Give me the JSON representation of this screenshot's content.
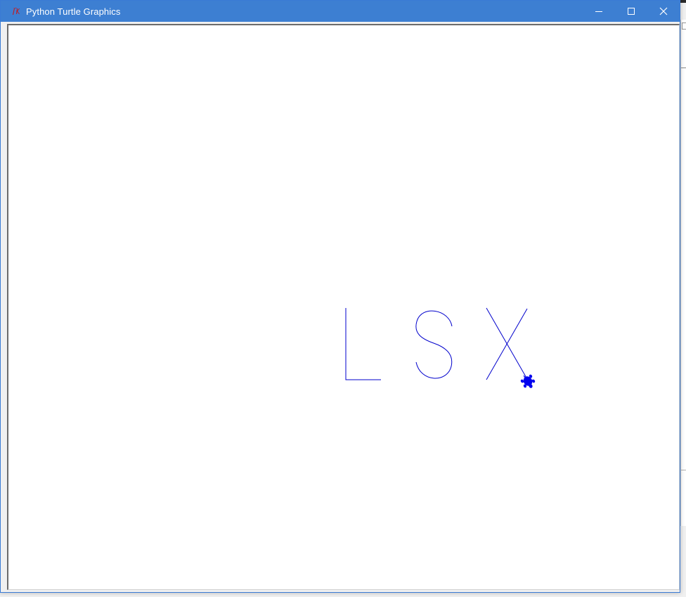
{
  "window": {
    "title": "Python Turtle Graphics",
    "icon": "tk-icon",
    "titlebar_color": "#3d7fd2"
  },
  "controls": {
    "minimize_icon": "minimize-icon",
    "maximize_icon": "maximize-icon",
    "close_icon": "close-icon"
  },
  "canvas": {
    "background": "#ffffff",
    "pen_color": "#0000cc",
    "turtle_color": "#0000ee",
    "drawn_letters": [
      "L",
      "S",
      "X"
    ]
  }
}
